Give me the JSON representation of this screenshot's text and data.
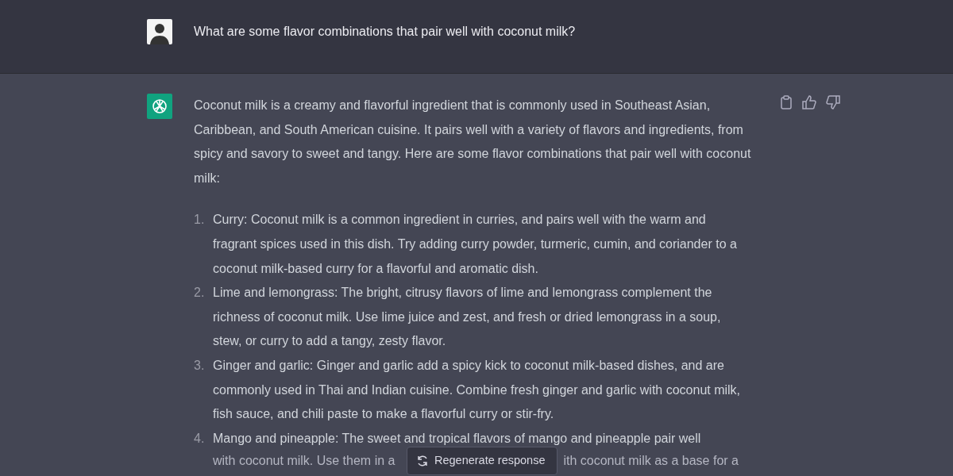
{
  "question": {
    "text": "What are some flavor combinations that pair well with coconut milk?"
  },
  "answer": {
    "intro": "Coconut milk is a creamy and flavorful ingredient that is commonly used in Southeast Asian, Caribbean, and South American cuisine. It pairs well with a variety of flavors and ingredients, from spicy and savory to sweet and tangy. Here are some flavor combinations that pair well with coconut milk:",
    "items": [
      {
        "number": "1.",
        "text": "Curry: Coconut milk is a common ingredient in curries, and pairs well with the warm and fragrant spices used in this dish. Try adding curry powder, turmeric, cumin, and coriander to a coconut milk-based curry for a flavorful and aromatic dish."
      },
      {
        "number": "2.",
        "text": "Lime and lemongrass: The bright, citrusy flavors of lime and lemongrass complement the richness of coconut milk. Use lime juice and zest, and fresh or dried lemongrass in a soup, stew, or curry to add a tangy, zesty flavor."
      },
      {
        "number": "3.",
        "text": "Ginger and garlic: Ginger and garlic add a spicy kick to coconut milk-based dishes, and are commonly used in Thai and Indian cuisine. Combine fresh ginger and garlic with coconut milk, fish sauce, and chili paste to make a flavorful curry or stir-fry."
      },
      {
        "number": "4.",
        "text": "Mango and pineapple: The sweet and tropical flavors of mango and pineapple pair well",
        "partial_left": "with coconut milk. Use them in a",
        "partial_right": "ith coconut milk as a base for a"
      }
    ]
  },
  "regenerate_button": {
    "label": "Regenerate response"
  }
}
